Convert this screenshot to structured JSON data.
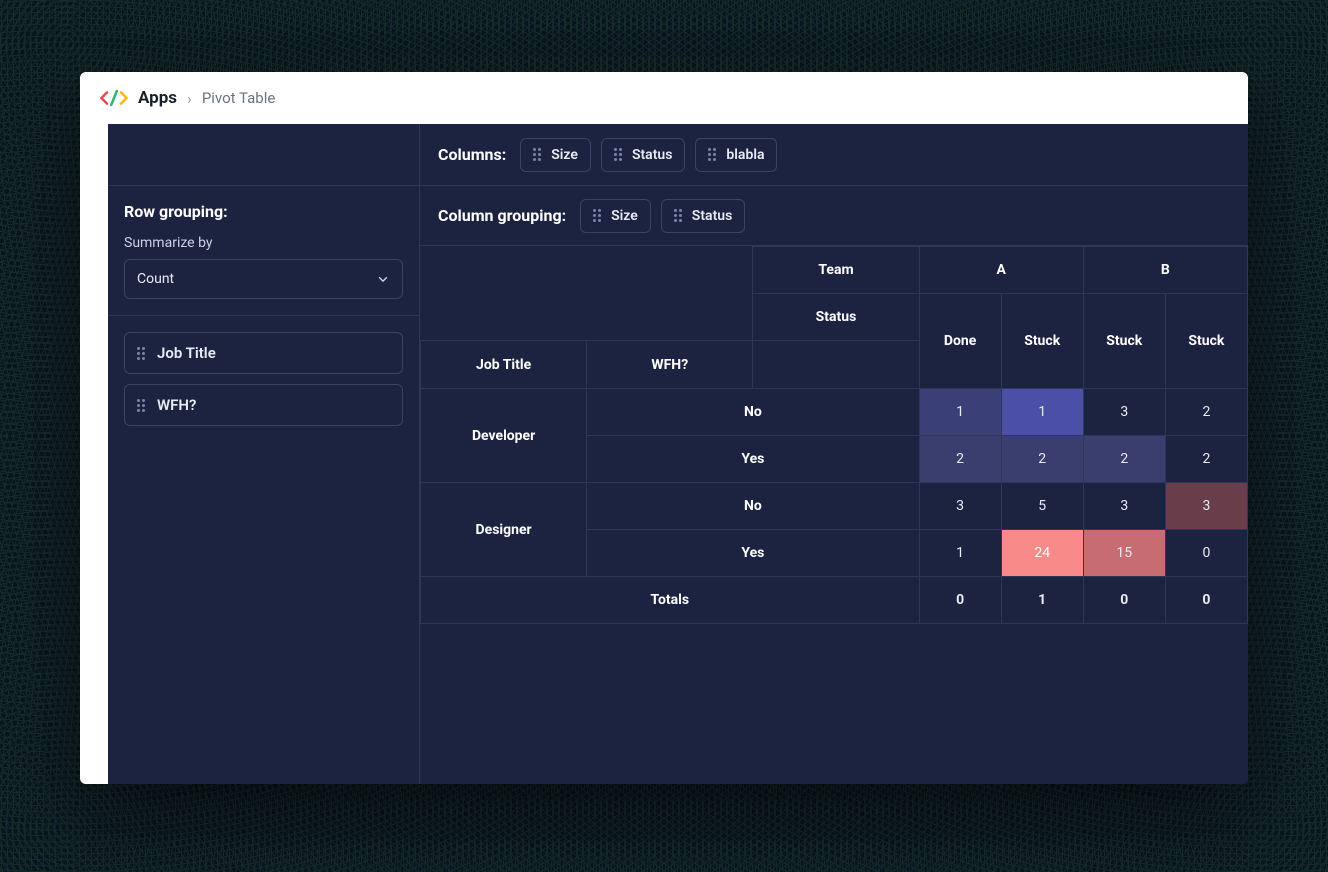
{
  "header": {
    "app_name": "Apps",
    "crumb_sep": "›",
    "page": "Pivot Table"
  },
  "sidebar": {
    "row_grouping_title": "Row grouping:",
    "summarize_label": "Summarize by",
    "summarize_value": "Count",
    "row_chips": [
      "Job Title",
      "WFH?"
    ]
  },
  "config": {
    "columns_label": "Columns:",
    "columns_chips": [
      "Size",
      "Status",
      "blabla"
    ],
    "col_grouping_label": "Column grouping:",
    "col_grouping_chips": [
      "Size",
      "Status"
    ]
  },
  "pivot": {
    "header_team_label": "Team",
    "header_status_label": "Status",
    "row_headers": [
      "Job Title",
      "WFH?"
    ],
    "team_cols": [
      "A",
      "B"
    ],
    "status_cols": [
      "Done",
      "Stuck",
      "Stuck",
      "Stuck"
    ],
    "groups": [
      {
        "name": "Developer",
        "rows": [
          {
            "wfh": "No",
            "vals": [
              "1",
              "1",
              "3",
              "2"
            ],
            "styles": [
              "heat-b1",
              "heat-b2",
              "",
              ""
            ]
          },
          {
            "wfh": "Yes",
            "vals": [
              "2",
              "2",
              "2",
              "2"
            ],
            "styles": [
              "heat-b3",
              "heat-b3",
              "heat-b3",
              ""
            ]
          }
        ]
      },
      {
        "name": "Designer",
        "rows": [
          {
            "wfh": "No",
            "vals": [
              "3",
              "5",
              "3",
              "3"
            ],
            "styles": [
              "",
              "",
              "",
              "heat-r1"
            ]
          },
          {
            "wfh": "Yes",
            "vals": [
              "1",
              "24",
              "15",
              "0"
            ],
            "styles": [
              "",
              "heat-r2",
              "heat-r3",
              ""
            ]
          }
        ]
      }
    ],
    "totals_label": "Totals",
    "totals": [
      "0",
      "1",
      "0",
      "0"
    ]
  }
}
